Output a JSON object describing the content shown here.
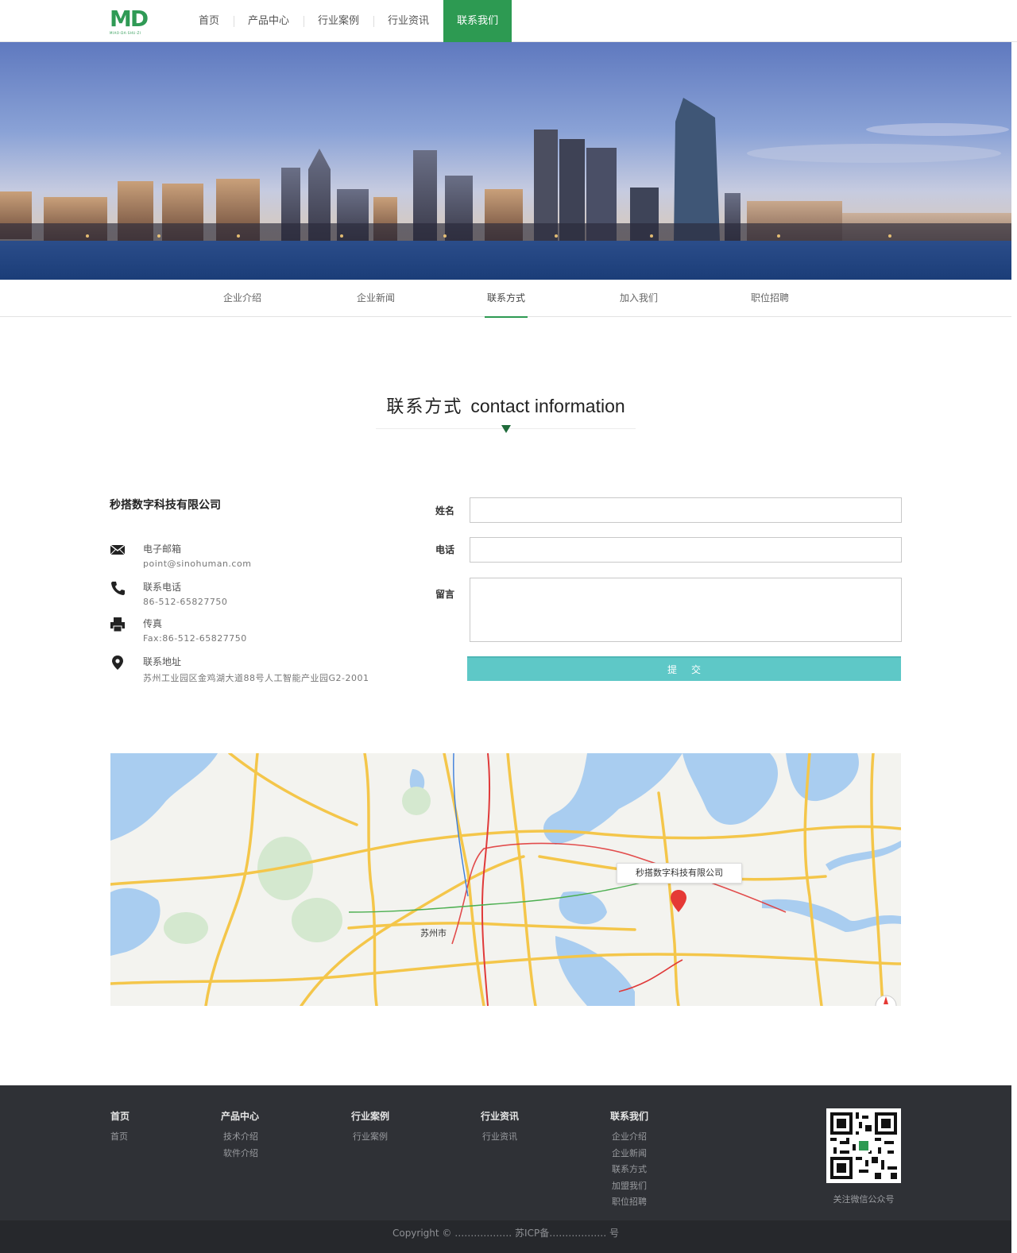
{
  "header": {
    "logo_text": "MD",
    "logo_sub": "MIAO·DA·SHU·ZI",
    "nav": [
      "首页",
      "产品中心",
      "行业案例",
      "行业资讯",
      "联系我们"
    ],
    "active_nav": "联系我们"
  },
  "subnav": {
    "items": [
      "企业介绍",
      "企业新闻",
      "联系方式",
      "加入我们",
      "职位招聘"
    ],
    "active": "联系方式"
  },
  "section": {
    "title_cn": "联系方式",
    "title_en": "contact information"
  },
  "contact": {
    "company": "秒搭数字科技有限公司",
    "email_label": "电子邮箱",
    "email_value": "point@sinohuman.com",
    "phone_label": "联系电话",
    "phone_value": "86-512-65827750",
    "fax_label": "传真",
    "fax_value": "Fax:86-512-65827750",
    "address_label": "联系地址",
    "address_value": "苏州工业园区金鸡湖大道88号人工智能产业园G2-2001"
  },
  "form": {
    "name_label": "姓名",
    "phone_label": "电话",
    "message_label": "留言",
    "name_value": "",
    "phone_value": "",
    "message_value": "",
    "submit_label": "提交"
  },
  "map": {
    "popup_label": "秒搭数字科技有限公司",
    "city_label": "苏州市"
  },
  "footer": {
    "columns": [
      {
        "title": "首页",
        "links": [
          "首页"
        ]
      },
      {
        "title": "产品中心",
        "links": [
          "技术介绍",
          "软件介绍"
        ]
      },
      {
        "title": "行业案例",
        "links": [
          "行业案例"
        ]
      },
      {
        "title": "行业资讯",
        "links": [
          "行业资讯"
        ]
      },
      {
        "title": "联系我们",
        "links": [
          "企业介绍",
          "企业新闻",
          "联系方式",
          "加盟我们",
          "职位招聘"
        ]
      }
    ],
    "qr_caption": "关注微信公众号",
    "copyright": "Copyright © ……………… 苏ICP备……………… 号"
  },
  "colors": {
    "brand_green": "#2d9a52",
    "submit": "#5ec8c7",
    "footer_bg": "#2f3136",
    "copyright_bg": "#26282c",
    "map_pin": "#e53935"
  }
}
